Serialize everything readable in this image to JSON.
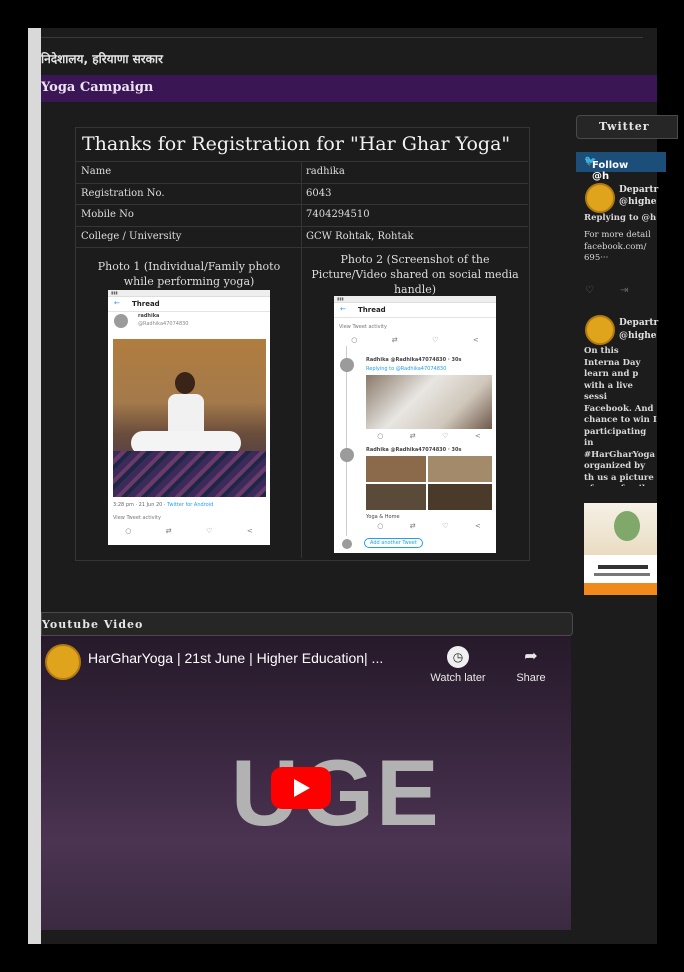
{
  "header": {
    "department": "निदेशालय, हरियाणा सरकार",
    "section": "Yoga Campaign"
  },
  "registration": {
    "title": "Thanks for Registration for \"Har Ghar Yoga\"",
    "rows": [
      {
        "label": "Name",
        "value": "radhika"
      },
      {
        "label": "Registration No.",
        "value": "6043"
      },
      {
        "label": "Mobile No",
        "value": "7404294510"
      },
      {
        "label": "College / University",
        "value": "GCW Rohtak, Rohtak"
      }
    ],
    "photo1_heading": "Photo 1 (Individual/Family photo while performing yoga)",
    "photo2_heading": "Photo 2 (Screenshot of the Picture/Video shared on social media handle)",
    "shot1": {
      "header": "Thread",
      "user": "radhika",
      "handle": "@Radhika47074830",
      "timestamp": "3:28 pm · 21 Jun 20 ·",
      "client": "Twitter for Android",
      "activity": "View Tweet activity"
    },
    "shot2": {
      "header": "Thread",
      "activity": "View Tweet activity",
      "reply1_user": "Radhika @Radhika47074830 · 30s",
      "reply1_to": "Replying to @Radhika47074830",
      "reply2_user": "Radhika @Radhika47074830 · 30s",
      "reply2_text": "Yoga & Home",
      "add_tweet": "Add another Tweet"
    }
  },
  "twitter": {
    "tab": "Twitter",
    "follow": "Follow @h",
    "tweet1": {
      "name": "Departr",
      "handle": "@highe",
      "reply_to": "Replying to @h",
      "text": "For more detail facebook.com/ 695···"
    },
    "tweet2": {
      "name": "Departr",
      "handle": "@highe",
      "text": "On this Interna Day learn and p with a live sessi Facebook. And chance to win I participating in #HarGharYoga organized by th us a picture of your family doi the Har Ghar Y"
    }
  },
  "youtube": {
    "tab": "Youtube Video",
    "title": "HarGharYoga | 21st June | Higher Education| ...",
    "watch_later": "Watch later",
    "share": "Share",
    "thumb_text": "UGE"
  },
  "colors": {
    "purple_bar": "#3b1655",
    "youtube_red": "#ff0000",
    "twitter_blue": "#1da1f2"
  }
}
